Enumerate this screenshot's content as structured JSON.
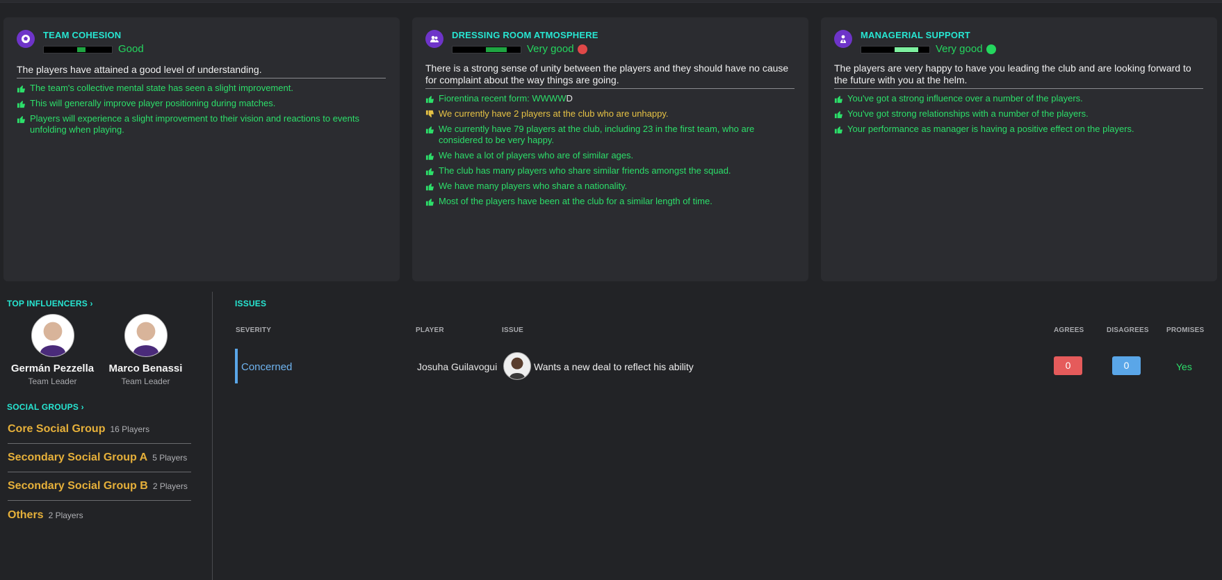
{
  "colors": {
    "accent": "#27e6d2",
    "positive": "#2cdf6a",
    "negative": "#e6c245",
    "group": "#e6b03a",
    "purple": "#6e34c9"
  },
  "cards": [
    {
      "title": "TEAM COHESION",
      "icon": "football-icon",
      "rating": "Good",
      "level": 0.55,
      "description": "The players have attained a good level of understanding.",
      "facts": [
        {
          "text": "The team's collective mental state has seen a slight improvement.",
          "positive": true
        },
        {
          "text": "This will generally improve player positioning during matches.",
          "positive": true
        },
        {
          "text": "Players will experience a slight improvement to their vision and reactions to events unfolding when playing.",
          "positive": true
        }
      ]
    },
    {
      "title": "DRESSING ROOM ATMOSPHERE",
      "icon": "group-icon",
      "rating": "Very good",
      "level": 0.8,
      "description": "There is a strong sense of unity between the players and they should have no cause for complaint about the way things are going.",
      "facts": [
        {
          "text": "Fiorentina recent form: WWWW",
          "form_last": "D",
          "positive": true
        },
        {
          "text": "We currently have 2 players at the club who are unhappy.",
          "positive": false
        },
        {
          "text": "We currently have 79 players at the club, including 23 in the first team, who are considered to be very happy.",
          "positive": true
        },
        {
          "text": "We have a lot of players who are of similar ages.",
          "positive": true
        },
        {
          "text": "The club has many players who share similar friends amongst the squad.",
          "positive": true
        },
        {
          "text": "We have many players who share a nationality.",
          "positive": true
        },
        {
          "text": "Most of the players have been at the club for a similar length of time.",
          "positive": true
        }
      ]
    },
    {
      "title": "MANAGERIAL SUPPORT",
      "icon": "manager-icon",
      "rating": "Very good",
      "level": 0.85,
      "description": "The players are very happy to have you leading the club and are looking forward to the future with you at the helm.",
      "facts": [
        {
          "text": "You've got a strong influence over a number of the players.",
          "positive": true
        },
        {
          "text": "You've got strong relationships with a number of the players.",
          "positive": true
        },
        {
          "text": "Your performance as manager is having a positive effect on the players.",
          "positive": true
        }
      ]
    }
  ],
  "influencers": {
    "label": "TOP INFLUENCERS",
    "people": [
      {
        "name": "Germán Pezzella",
        "role": "Team Leader"
      },
      {
        "name": "Marco Benassi",
        "role": "Team Leader"
      }
    ]
  },
  "social_groups": {
    "label": "SOCIAL GROUPS",
    "groups": [
      {
        "name": "Core Social Group",
        "count": "16 Players"
      },
      {
        "name": "Secondary Social Group A",
        "count": "5 Players"
      },
      {
        "name": "Secondary Social Group B",
        "count": "2 Players"
      },
      {
        "name": "Others",
        "count": "2 Players"
      }
    ]
  },
  "issues": {
    "title": "ISSUES",
    "columns": {
      "severity": "SEVERITY",
      "player": "PLAYER",
      "issue": "ISSUE",
      "agrees": "AGREES",
      "disagrees": "DISAGREES",
      "promises": "PROMISES"
    },
    "rows": [
      {
        "severity": "Concerned",
        "player": "Josuha Guilavogui",
        "issue": "Wants a new deal to reflect his ability",
        "agrees": "0",
        "disagrees": "0",
        "promises": "Yes"
      }
    ]
  }
}
